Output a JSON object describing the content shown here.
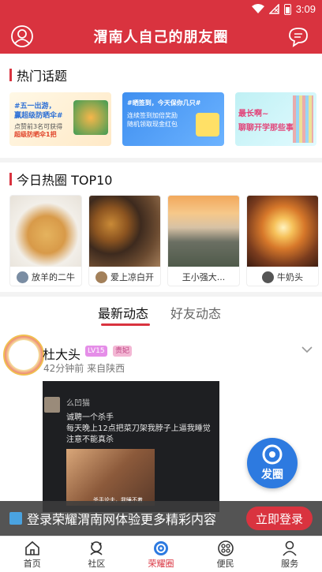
{
  "status": {
    "time": "3:09"
  },
  "header": {
    "title": "渭南人自己的朋友圈"
  },
  "hot_topics": {
    "title": "热门话题",
    "banners": [
      {
        "line1": "#五一出游，",
        "line2": "赢超级防晒伞#",
        "line3": "点赞前3名可获得",
        "line4": "超级防晒伞1把"
      },
      {
        "line1": "#晒签到，今天保你几只#",
        "line2": "连续签到加倍奖励",
        "line3": "随机领取现金红包"
      },
      {
        "line1": "最长啊~",
        "line2": "聊聊开学那些事"
      }
    ]
  },
  "top10": {
    "title": "今日热圈 TOP10",
    "items": [
      {
        "label": "放羊的二牛"
      },
      {
        "label": "爱上凉白开"
      },
      {
        "label": "王小强大..."
      },
      {
        "label": "牛奶头"
      }
    ]
  },
  "feed_tabs": {
    "latest": "最新动态",
    "friends": "好友动态"
  },
  "post": {
    "author": "杜大头",
    "level": "LV15",
    "vip": "贵妃",
    "meta": "42分钟前 来自陕西",
    "image": {
      "user": "么凹猫",
      "lines": [
        "诚聘一个杀手",
        "每天晚上12点把菜刀架我脖子上逼我睡觉",
        "注意不能真杀"
      ],
      "caption": "杀手论夫，我睡不着"
    }
  },
  "fab": {
    "label": "发圈"
  },
  "login_banner": {
    "text": "登录荣耀渭南网体验更多精彩内容",
    "button": "立即登录"
  },
  "bottom_nav": [
    {
      "label": "首页",
      "icon": "home-icon"
    },
    {
      "label": "社区",
      "icon": "community-icon"
    },
    {
      "label": "荣耀圈",
      "icon": "honor-circle-icon"
    },
    {
      "label": "便民",
      "icon": "services-icon"
    },
    {
      "label": "服务",
      "icon": "profile-icon"
    }
  ],
  "colors": {
    "primary": "#d9333f",
    "fab": "#2d7ae0"
  }
}
